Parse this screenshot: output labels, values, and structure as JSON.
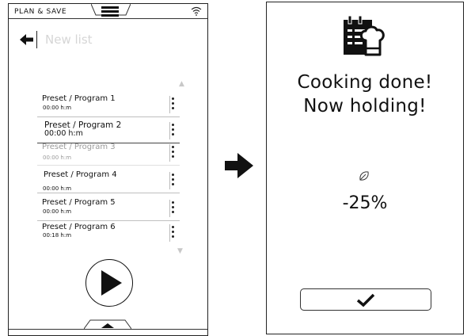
{
  "left_screen": {
    "header_title": "PLAN & SAVE",
    "title_placeholder": "New list",
    "items": [
      {
        "name": "Preset / Program 1",
        "time": "00:00 h:m"
      },
      {
        "name": "Preset / Program 2",
        "time": "00:00 h:m"
      },
      {
        "name": "Preset / Program 3",
        "time": "00:00 h:m"
      },
      {
        "name": "Preset / Program 4",
        "time": "00:00 h:m"
      },
      {
        "name": "Preset / Program 5",
        "time": "00:00 h:m"
      },
      {
        "name": "Preset / Program 6",
        "time": "00:18 h:m"
      }
    ],
    "scroll_up_glyph": "▲",
    "scroll_down_glyph": "▼"
  },
  "right_screen": {
    "status_line1": "Cooking done!",
    "status_line2": "Now holding!",
    "saving_value": "-25%"
  },
  "icons": {
    "menu": "hamburger-icon",
    "wifi": "wifi-icon",
    "back": "back-arrow-icon",
    "play": "play-icon",
    "transition": "right-arrow-icon",
    "chef": "chef-calendar-icon",
    "eco": "leaf-icon",
    "confirm": "checkmark-icon"
  },
  "colors": {
    "ink": "#111111",
    "placeholder": "#d6d6d6",
    "muted_item": "#9a9a9a"
  }
}
